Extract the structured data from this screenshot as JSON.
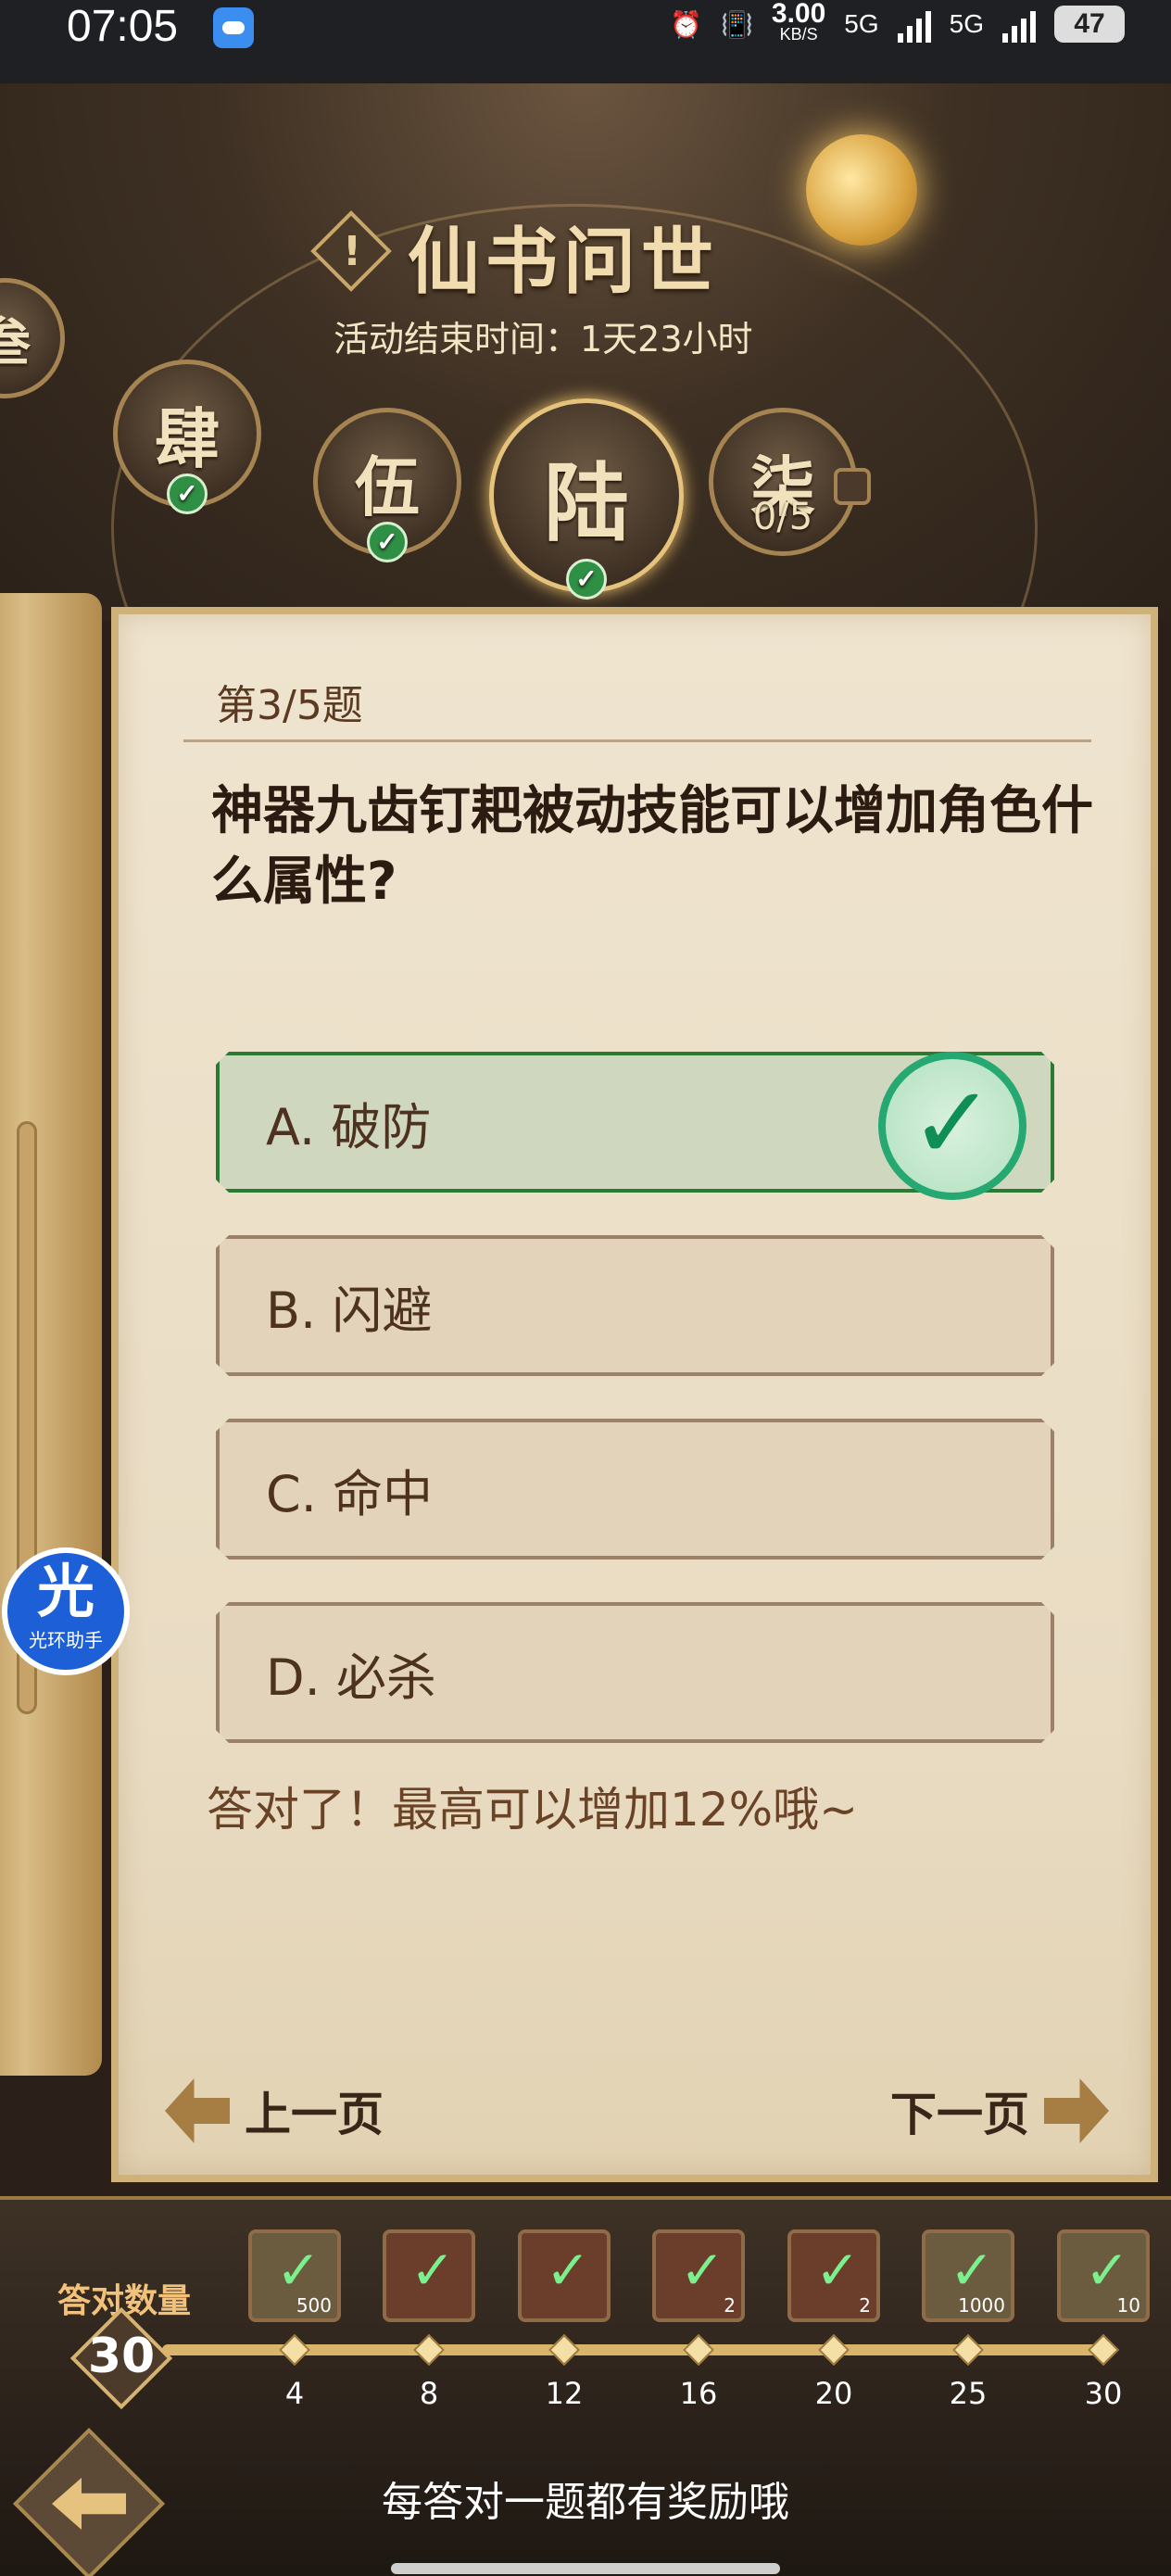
{
  "status_bar": {
    "time": "07:05",
    "speed_value": "3.00",
    "speed_unit": "KB/S",
    "net1": "5G",
    "net2": "5G",
    "battery": "47"
  },
  "event": {
    "title": "仙书问世",
    "end_time": "活动结束时间：1天23小时"
  },
  "chapters": [
    {
      "label": "叁",
      "completed": true
    },
    {
      "label": "肆",
      "completed": true
    },
    {
      "label": "伍",
      "completed": true
    },
    {
      "label": "陆",
      "completed": true,
      "current": true
    },
    {
      "label": "柒",
      "completed": false,
      "progress": "0/5",
      "locked": true
    }
  ],
  "quiz": {
    "question_number": "第3/5题",
    "question": "神器九齿钉耙被动技能可以增加角色什么属性?",
    "options": [
      {
        "label": "A. 破防",
        "correct": true
      },
      {
        "label": "B. 闪避"
      },
      {
        "label": "C. 命中"
      },
      {
        "label": "D. 必杀"
      }
    ],
    "feedback": "答对了！最高可以增加12%哦~",
    "prev_label": "上一页",
    "next_label": "下一页"
  },
  "helper": {
    "glyph": "光",
    "label": "光环助手"
  },
  "rewards": {
    "count_label": "答对数量",
    "count_value": "30",
    "milestones": [
      {
        "label": "4",
        "type": "scroll",
        "qty": "500"
      },
      {
        "label": "8",
        "type": "chest",
        "qty": ""
      },
      {
        "label": "12",
        "type": "chest",
        "qty": ""
      },
      {
        "label": "16",
        "type": "chest",
        "qty": "2"
      },
      {
        "label": "20",
        "type": "chest",
        "qty": "2"
      },
      {
        "label": "25",
        "type": "scroll",
        "qty": "1000"
      },
      {
        "label": "30",
        "type": "gear",
        "qty": "10"
      }
    ],
    "hint": "每答对一题都有奖励哦"
  },
  "colors": {
    "correct_border": "#2a7a34",
    "check_green": "#26a872",
    "gold": "#d8b56a"
  }
}
